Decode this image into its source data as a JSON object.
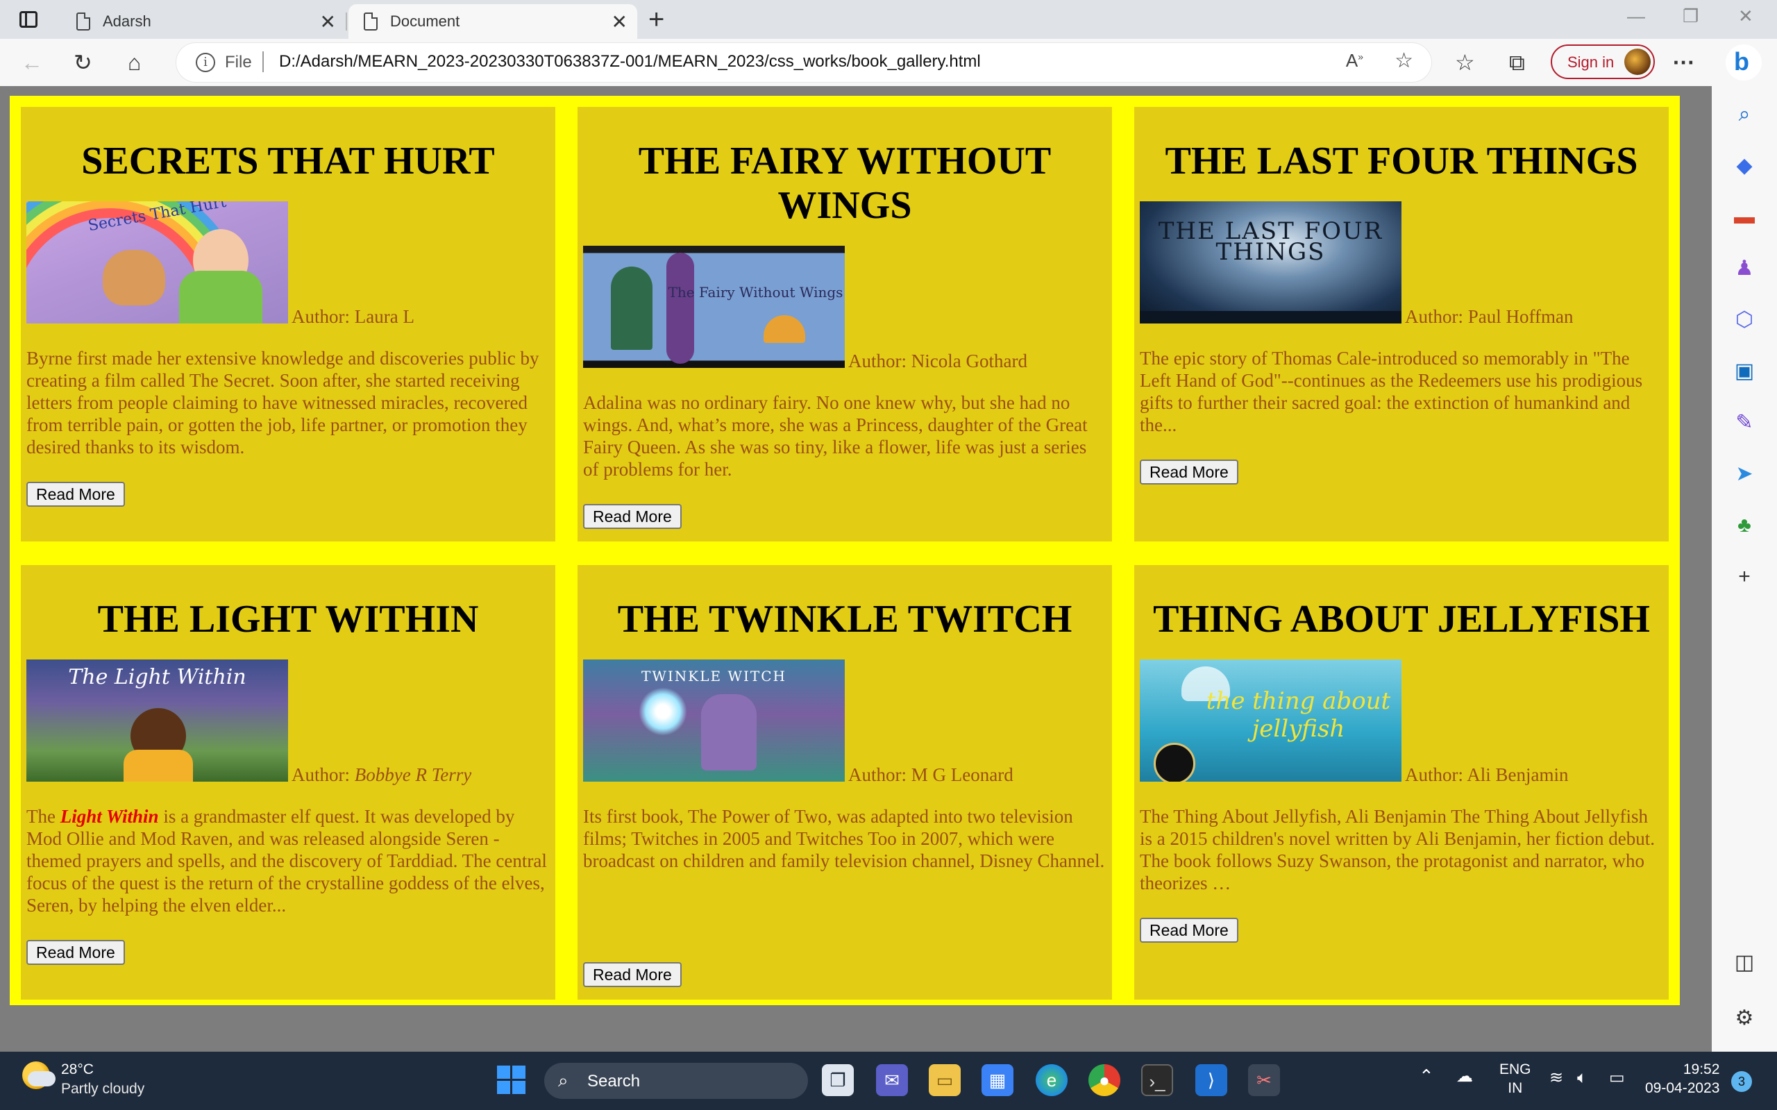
{
  "browser": {
    "tabs": [
      {
        "label": "Adarsh"
      },
      {
        "label": "Document"
      }
    ],
    "address": {
      "info_label": "File",
      "url": "D:/Adarsh/MEARN_2023-20230330T063837Z-001/MEARN_2023/css_works/book_gallery.html"
    },
    "signin_label": "Sign in"
  },
  "books": [
    {
      "title": "SECRETS THAT HURT",
      "author_prefix": "Author: ",
      "author": "Laura L",
      "desc": "Byrne first made her extensive knowledge and discoveries public by creating a film called The Secret. Soon after, she started receiving letters from people claiming to have witnessed miracles, recovered from terrible pain, or gotten the job, life partner, or promotion they desired thanks to its wisdom.",
      "button": "Read More",
      "cover_text": "Secrets That Hurt"
    },
    {
      "title": "THE FAIRY WITHOUT WINGS",
      "author_prefix": "Author: ",
      "author": "Nicola Gothard",
      "desc": "Adalina was no ordinary fairy. No one knew why, but she had no wings. And, what’s more, she was a Princess, daughter of the Great Fairy Queen. As she was so tiny, like a flower, life was just a series of problems for her.",
      "button": "Read More",
      "cover_text": "The Fairy Without Wings"
    },
    {
      "title": "THE LAST FOUR THINGS",
      "author_prefix": "Author: ",
      "author": "Paul Hoffman",
      "desc": "The epic story of Thomas Cale-introduced so memorably in \"The Left Hand of God\"--continues as the Redeemers use his prodigious gifts to further their sacred goal: the extinction of humankind and the...",
      "button": "Read More",
      "cover_text": "THE LAST FOUR THINGS"
    },
    {
      "title": "THE LIGHT WITHIN",
      "author_prefix": "Author: ",
      "author": "Bobbye R Terry",
      "desc_prefix": "The ",
      "desc_highlight": "Light Within",
      "desc": " is a grandmaster elf quest. It was developed by Mod Ollie and Mod Raven, and was released alongside Seren - themed prayers and spells, and the discovery of Tarddiad. The central focus of the quest is the return of the crystalline goddess of the elves, Seren, by helping the elven elder...",
      "button": "Read More",
      "cover_text": "The Light Within"
    },
    {
      "title": "THE TWINKLE TWITCH",
      "author_prefix": "Author: ",
      "author": "M G Leonard",
      "desc": "Its first book, The Power of Two, was adapted into two television films; Twitches in 2005 and Twitches Too in 2007, which were broadcast on children and family television channel, Disney Channel.",
      "button": "Read More",
      "cover_text": "TWINKLE WITCH"
    },
    {
      "title": "THING ABOUT JELLYFISH",
      "author_prefix": "Author: ",
      "author": "Ali Benjamin",
      "desc": "The Thing About Jellyfish, Ali Benjamin The Thing About Jellyfish is a 2015 children's novel written by Ali Benjamin, her fiction debut. The book follows Suzy Swanson, the protagonist and narrator, who theorizes …",
      "button": "Read More",
      "cover_text": "the thing about jellyfish"
    }
  ],
  "taskbar": {
    "temperature": "28°C",
    "condition": "Partly cloudy",
    "search_label": "Search",
    "lang_top": "ENG",
    "lang_bottom": "IN",
    "time": "19:52",
    "date": "09-04-2023",
    "notification_count": "3"
  },
  "colors": {
    "gallery_bg": "#ffff00",
    "card_bg": "#e3cd14",
    "text_brown": "#9b4f13",
    "highlight_red": "#e40000"
  }
}
